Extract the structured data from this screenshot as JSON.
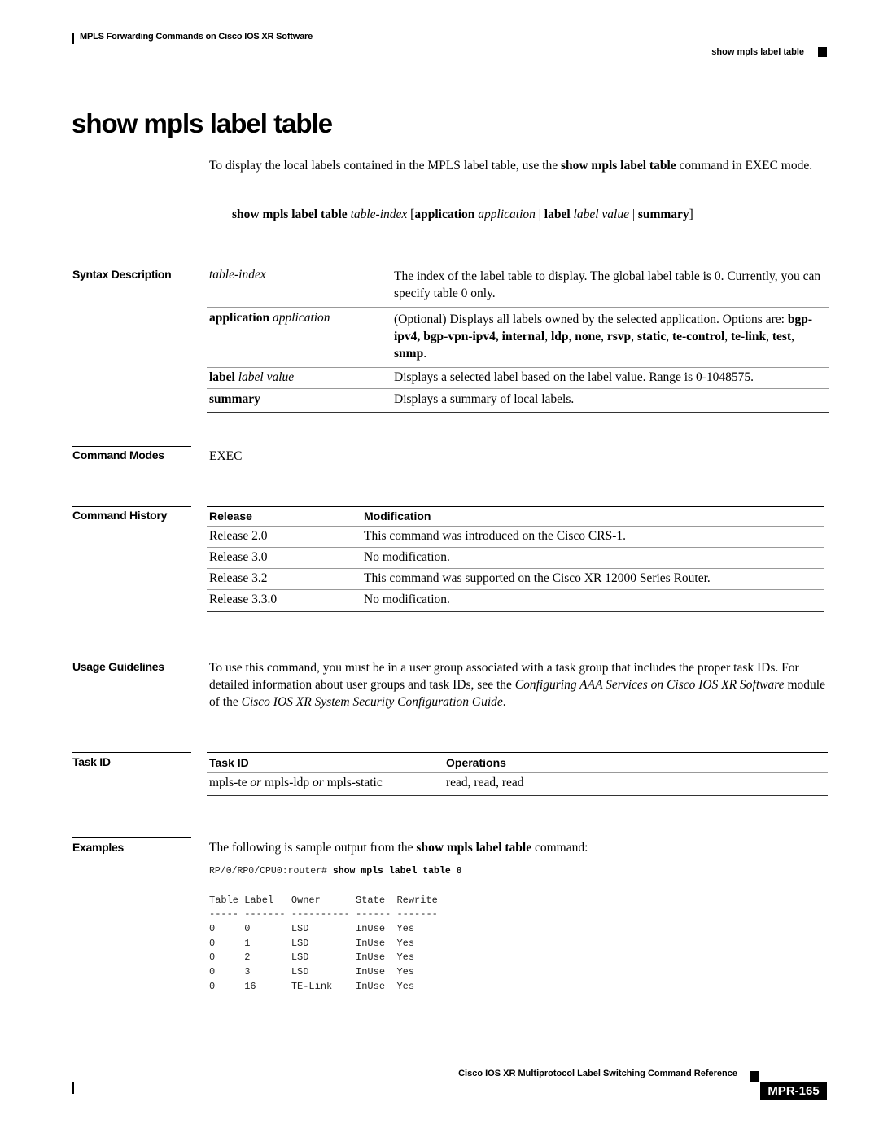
{
  "header": {
    "chapter": "MPLS Forwarding Commands on Cisco IOS XR Software",
    "running_title": "show mpls label table"
  },
  "title": "show mpls label table",
  "intro": {
    "pre": "To display the local labels contained in the MPLS label table, use the ",
    "cmd": "show mpls label table",
    "post": " command in EXEC mode."
  },
  "syntax": {
    "cmd": "show mpls label table",
    "arg": "table-index",
    "open": " [",
    "kw1": "application",
    "arg1": "application",
    "sep1": " | ",
    "kw2": "label",
    "arg2": "label value",
    "sep2": " | ",
    "kw3": "summary",
    "close": "]"
  },
  "syntax_description": {
    "label": "Syntax Description",
    "rows": [
      {
        "kw": "",
        "arg": "table-index",
        "desc": "The index of the label table to display. The global label table is 0. Currently, you can specify table 0 only."
      },
      {
        "kw": "application",
        "arg": "application",
        "desc_pre": "(Optional) Displays all labels owned by the selected application. Options are: ",
        "options": [
          "bgp-ipv4",
          "bgp-vpn-ipv4",
          "internal",
          "ldp",
          "none",
          "rsvp",
          "static",
          "te-control",
          "te-link",
          "test",
          "snmp"
        ]
      },
      {
        "kw": "label",
        "arg": "label value",
        "desc": "Displays a selected label based on the label value. Range is 0-1048575."
      },
      {
        "kw": "summary",
        "arg": "",
        "desc": "Displays a summary of local labels."
      }
    ]
  },
  "command_modes": {
    "label": "Command Modes",
    "value": "EXEC"
  },
  "command_history": {
    "label": "Command History",
    "headers": [
      "Release",
      "Modification"
    ],
    "rows": [
      {
        "release": "Release 2.0",
        "modification": "This command was introduced on the Cisco CRS-1."
      },
      {
        "release": "Release 3.0",
        "modification": "No modification."
      },
      {
        "release": "Release 3.2",
        "modification": "This command was supported on the Cisco XR 12000 Series Router."
      },
      {
        "release": "Release 3.3.0",
        "modification": "No modification."
      }
    ]
  },
  "usage_guidelines": {
    "label": "Usage Guidelines",
    "text_pre": "To use this command, you must be in a user group associated with a task group that includes the proper task IDs. For detailed information about user groups and task IDs, see the ",
    "ref1": "Configuring AAA Services on Cisco IOS XR Software",
    "text_mid": " module of the ",
    "ref2": "Cisco IOS XR System Security Configuration Guide",
    "text_post": "."
  },
  "task_id": {
    "label": "Task ID",
    "headers": [
      "Task ID",
      "Operations"
    ],
    "row": {
      "t1": "mpls-te",
      "or1": " or ",
      "t2": "mpls-ldp",
      "or2": " or ",
      "t3": "mpls-static",
      "ops": "read, read, read"
    }
  },
  "examples": {
    "label": "Examples",
    "intro_pre": "The following is sample output from the ",
    "intro_cmd": "show mpls label table",
    "intro_post": " command:",
    "prompt": "RP/0/RP0/CPU0:router# ",
    "command": "show mpls label table 0",
    "output_header": "Table Label   Owner      State  Rewrite",
    "output_divider": "----- ------- ---------- ------ -------",
    "output_rows": [
      "0     0       LSD        InUse  Yes",
      "0     1       LSD        InUse  Yes",
      "0     2       LSD        InUse  Yes",
      "0     3       LSD        InUse  Yes",
      "0     16      TE-Link    InUse  Yes"
    ]
  },
  "footer": {
    "book_title": "Cisco IOS XR Multiprotocol Label Switching Command Reference",
    "page_number": "MPR-165"
  }
}
